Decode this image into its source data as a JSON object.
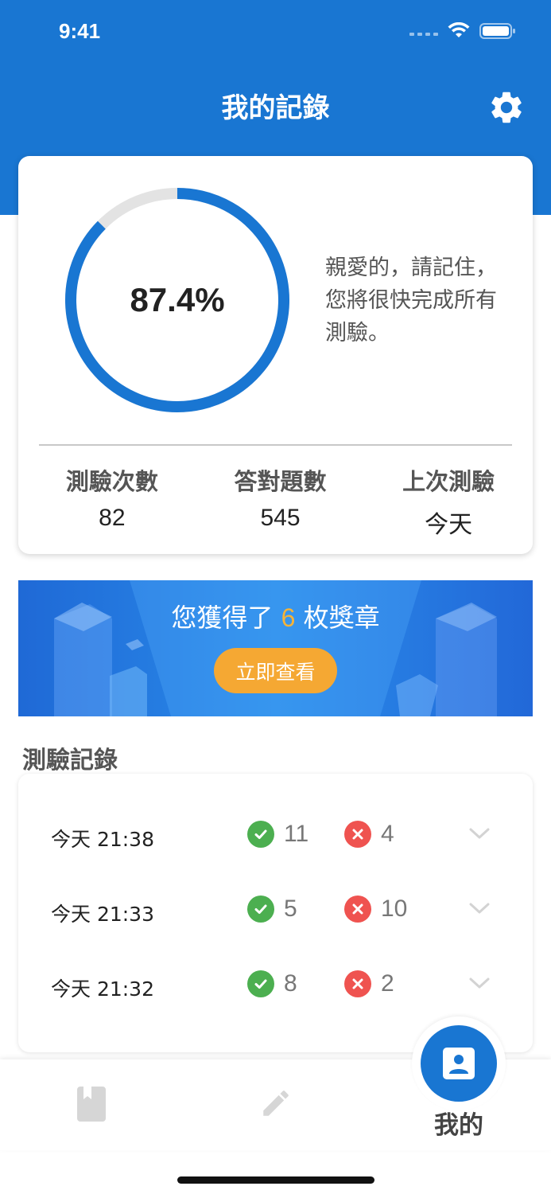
{
  "status_bar": {
    "time": "9:41"
  },
  "header": {
    "title": "我的記錄",
    "settings_icon": "gear-icon"
  },
  "summary": {
    "completion_text": "87.4%",
    "completion_fraction": 0.874,
    "message": "親愛的，請記住，您將很快完成所有測驗。",
    "stats": [
      {
        "label": "測驗次數",
        "value": "82"
      },
      {
        "label": "答對題數",
        "value": "545"
      },
      {
        "label": "上次測驗",
        "value": "今天"
      }
    ]
  },
  "badge_banner": {
    "text_before": "您獲得了",
    "count": "6",
    "text_after": "枚獎章",
    "button_label": "立即查看"
  },
  "records": {
    "title": "測驗記錄",
    "items": [
      {
        "time": "今天 21:38",
        "correct": "11",
        "wrong": "4"
      },
      {
        "time": "今天 21:33",
        "correct": "5",
        "wrong": "10"
      },
      {
        "time": "今天 21:32",
        "correct": "8",
        "wrong": "2"
      }
    ]
  },
  "tab_bar": {
    "tabs": [
      {
        "icon": "book-icon"
      },
      {
        "icon": "pencil-icon"
      },
      {
        "icon": "profile-card-icon",
        "label": "我的",
        "active": true
      }
    ]
  },
  "colors": {
    "primary": "#1976d2",
    "accent_orange": "#f5a833",
    "correct_green": "#4caf50",
    "wrong_red": "#ef5350"
  }
}
